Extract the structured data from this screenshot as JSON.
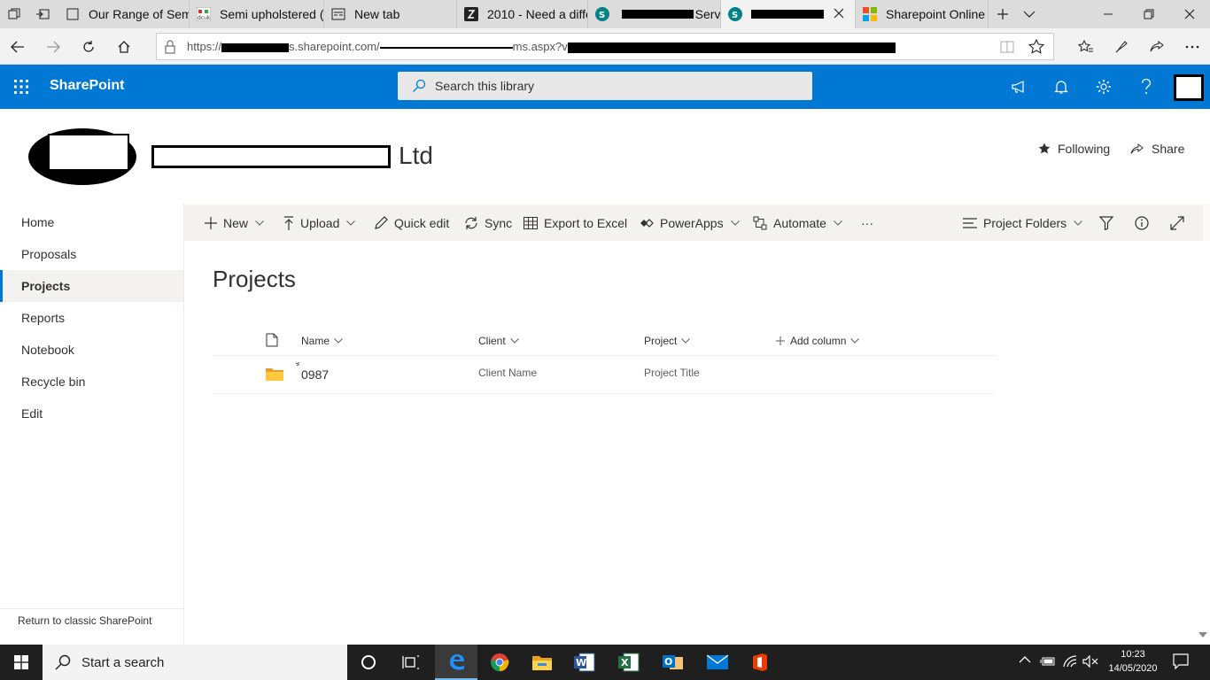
{
  "browser": {
    "tabs": [
      {
        "label": "Our Range of Semi",
        "icon": "page-icon"
      },
      {
        "label": "Semi upholstered (",
        "icon": "site-favicon"
      },
      {
        "label": "New tab",
        "icon": "newtab-icon"
      },
      {
        "label": "2010 - Need a diffe",
        "icon": "site-favicon"
      },
      {
        "label": "Serv",
        "icon": "sharepoint-icon"
      },
      {
        "label": "",
        "icon": "sharepoint-icon"
      },
      {
        "label": "Sharepoint Online",
        "icon": "microsoft-icon"
      }
    ],
    "address": {
      "url_prefix": "https://",
      "url_host": "s.sharepoint.com/",
      "url_path": "ms.aspx?v"
    }
  },
  "suite": {
    "app_name": "SharePoint",
    "search_placeholder": "Search this library"
  },
  "site": {
    "name_suffix": "Ltd",
    "following_label": "Following",
    "share_label": "Share"
  },
  "leftnav": {
    "items": [
      {
        "label": "Home"
      },
      {
        "label": "Proposals"
      },
      {
        "label": "Projects"
      },
      {
        "label": "Reports"
      },
      {
        "label": "Notebook"
      },
      {
        "label": "Recycle bin"
      },
      {
        "label": "Edit"
      }
    ],
    "classic_link": "Return to classic SharePoint"
  },
  "commandbar": {
    "new": "New",
    "upload": "Upload",
    "quick_edit": "Quick edit",
    "sync": "Sync",
    "export": "Export to Excel",
    "powerapps": "PowerApps",
    "automate": "Automate",
    "more": "···",
    "view": "Project Folders"
  },
  "library": {
    "title": "Projects",
    "columns": {
      "name": "Name",
      "client": "Client",
      "project": "Project",
      "add": "Add column"
    },
    "rows": [
      {
        "name": "0987",
        "client": "Client Name",
        "project": "Project Title"
      }
    ]
  },
  "taskbar": {
    "search_placeholder": "Start a search",
    "time": "10:23",
    "date": "14/05/2020"
  }
}
